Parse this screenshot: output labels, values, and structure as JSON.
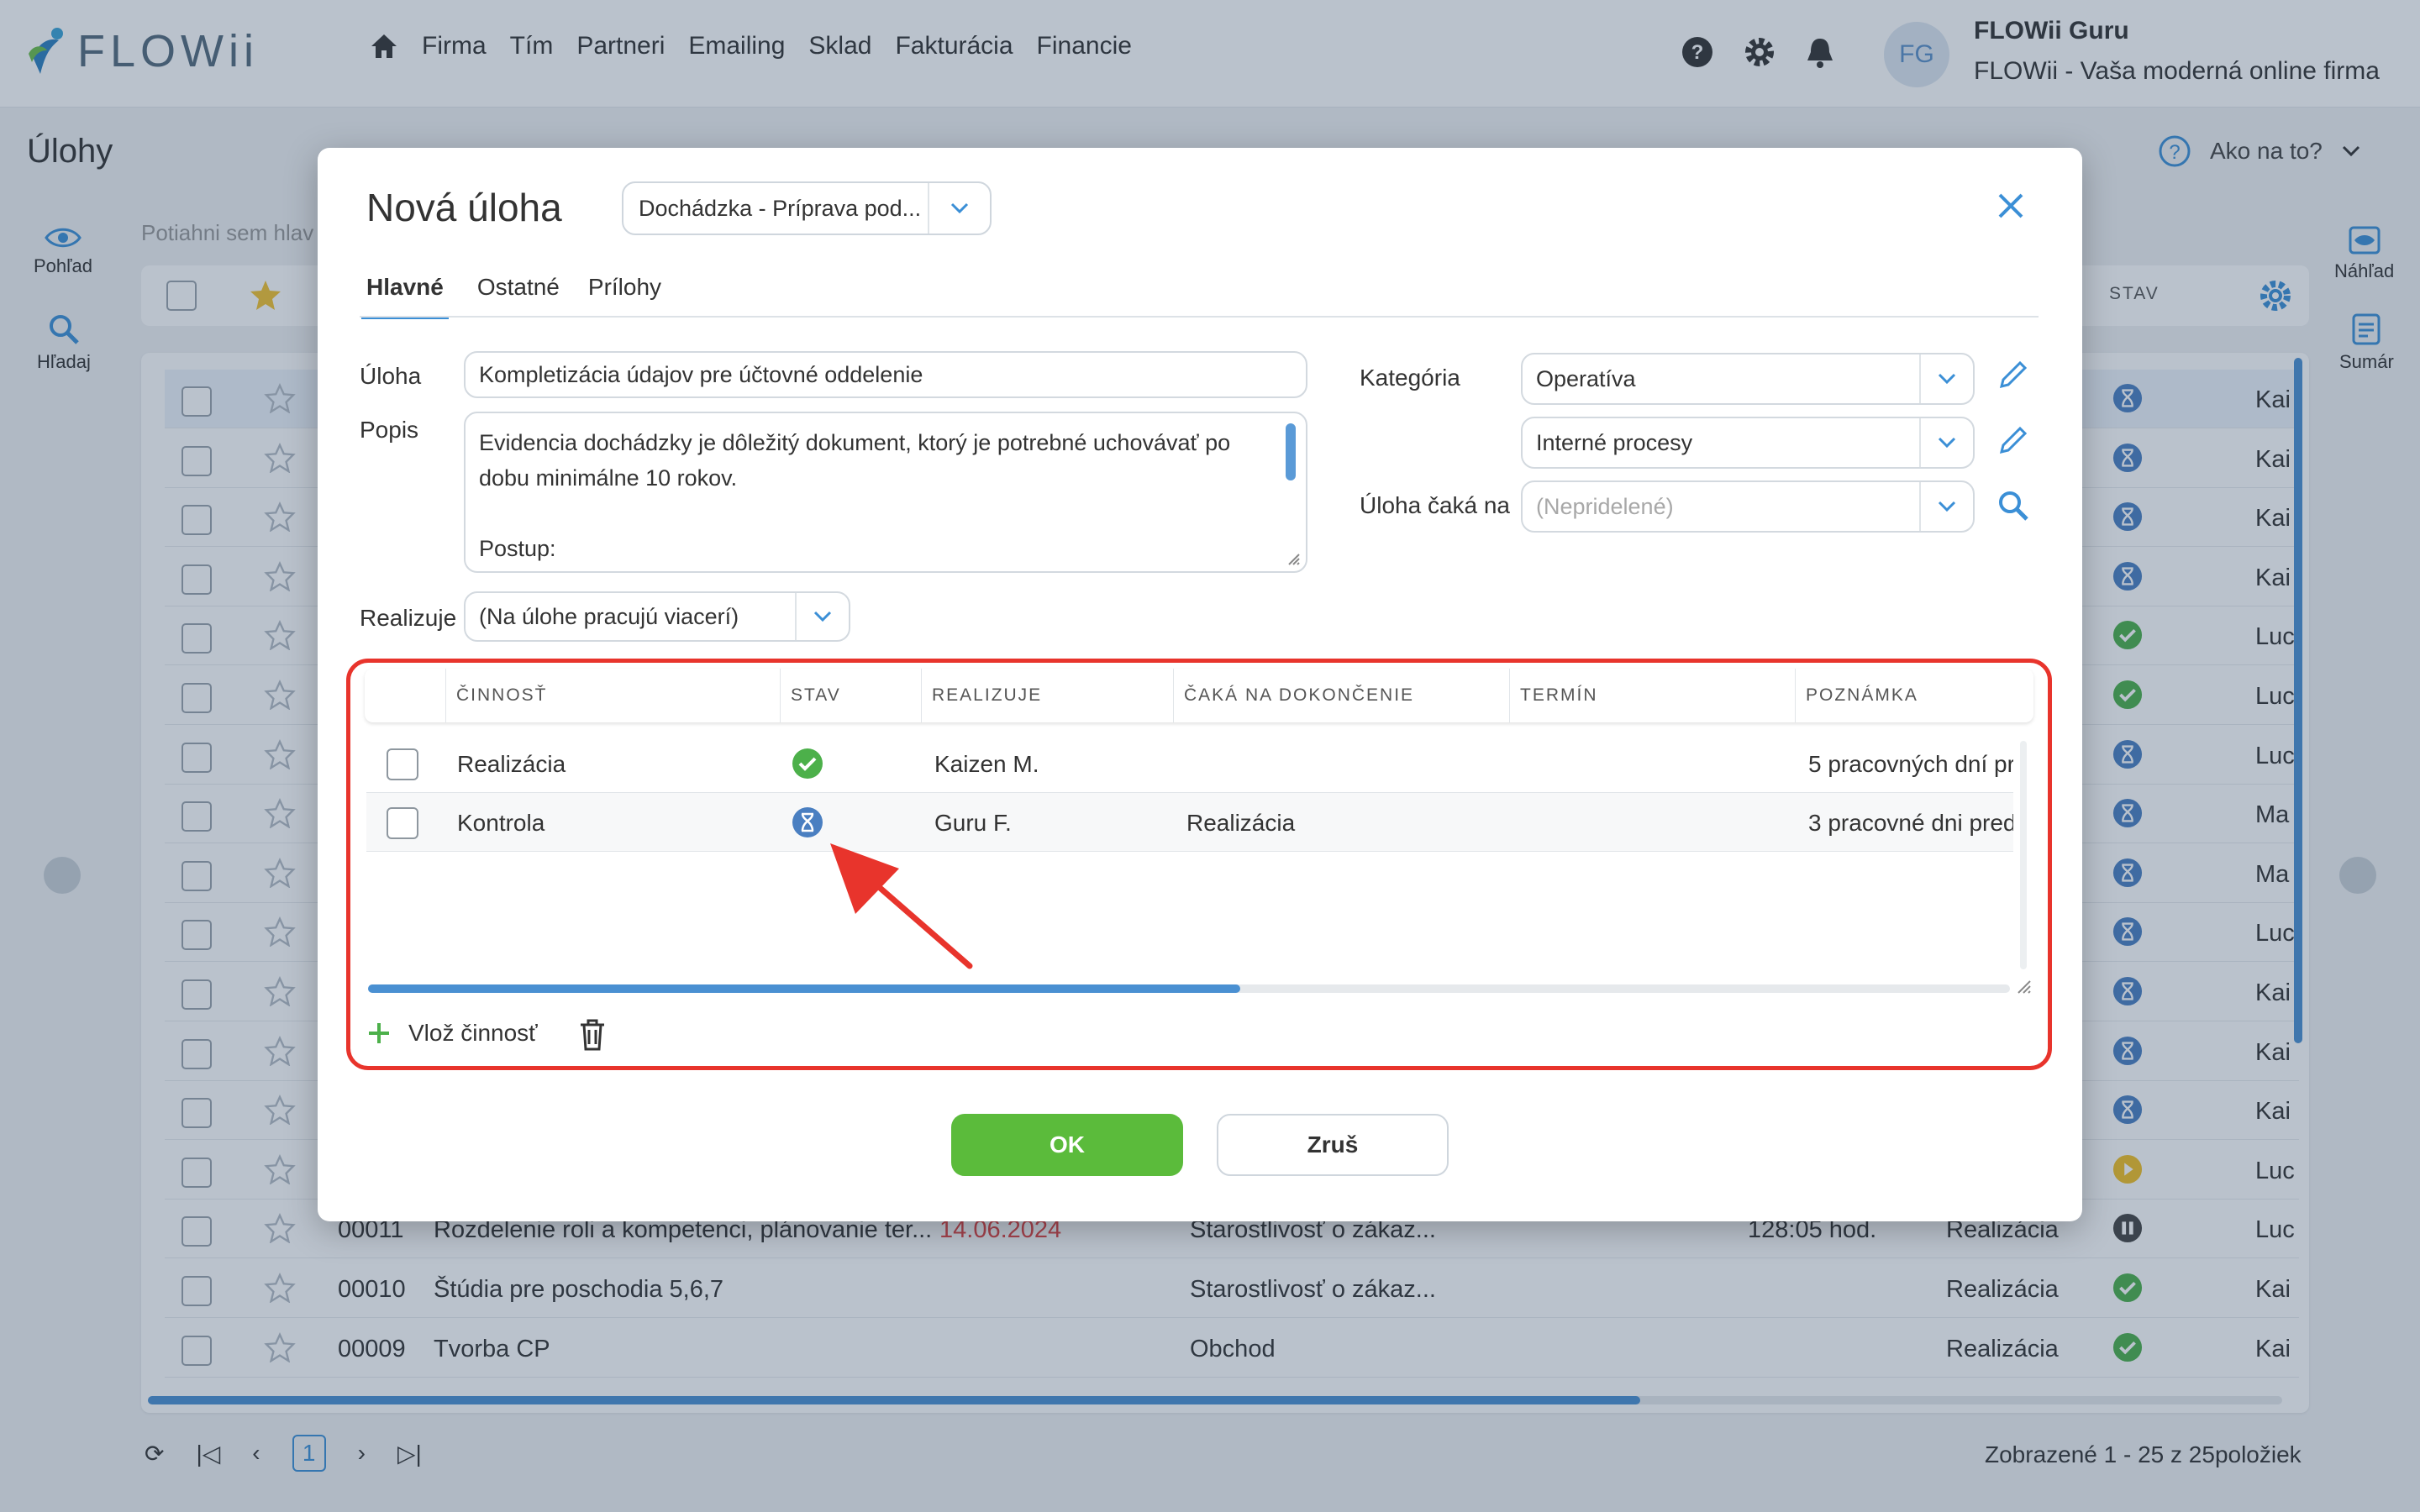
{
  "app": {
    "logo_text": "FLOWii"
  },
  "nav": [
    "Firma",
    "Tím",
    "Partneri",
    "Emailing",
    "Sklad",
    "Fakturácia",
    "Financie"
  ],
  "user": {
    "initials": "FG",
    "name": "FLOWii Guru",
    "company": "FLOWii - Vaša moderná online firma"
  },
  "page": {
    "title": "Úlohy",
    "help": "Ako na to?",
    "drag_hint": "Potiahni sem hlav",
    "status_col": "STAV",
    "pagination_info": "Zobrazené 1 - 25 z 25položiek",
    "current_page": "1"
  },
  "left_rail": [
    {
      "label": "Pohľad",
      "icon": "eye-icon"
    },
    {
      "label": "Hľadaj",
      "icon": "search-icon"
    }
  ],
  "right_rail": [
    {
      "label": "Náhľad",
      "icon": "preview-icon"
    },
    {
      "label": "Sumár",
      "icon": "summary-icon"
    }
  ],
  "background_rows": [
    {
      "status": "waiting",
      "who": "Kai"
    },
    {
      "status": "waiting",
      "who": "Kai"
    },
    {
      "status": "waiting",
      "who": "Kai"
    },
    {
      "status": "waiting",
      "who": "Kai"
    },
    {
      "status": "done",
      "who": "Luc"
    },
    {
      "status": "done",
      "who": "Luc"
    },
    {
      "status": "waiting",
      "who": "Luc"
    },
    {
      "status": "waiting",
      "who": "Ma"
    },
    {
      "status": "waiting",
      "who": "Ma"
    },
    {
      "status": "waiting",
      "who": "Luc"
    },
    {
      "status": "waiting",
      "who": "Kai"
    },
    {
      "status": "waiting",
      "who": "Kai"
    },
    {
      "status": "waiting",
      "who": "Kai"
    },
    {
      "status": "inprogress",
      "who": "Luc"
    },
    {
      "status": "paused",
      "who": "Luc",
      "num": "00011",
      "name": "Rozdelenie roli a kompetenci, plánovanie ter...",
      "date": "14.06.2024",
      "category": "Starostlivosť o zákaz...",
      "hours": "128:05 hod.",
      "phase": "Realizácia"
    },
    {
      "status": "done",
      "who": "Kai",
      "num": "00010",
      "name": "Štúdia pre poschodia 5,6,7",
      "category": "Starostlivosť o zákaz...",
      "phase": "Realizácia"
    },
    {
      "status": "done",
      "who": "Kai",
      "num": "00009",
      "name": "Tvorba CP",
      "category": "Obchod",
      "phase": "Realizácia"
    }
  ],
  "dialog": {
    "title": "Nová úloha",
    "template": "Dochádzka - Príprava pod...",
    "tabs": [
      "Hlavné",
      "Ostatné",
      "Prílohy"
    ],
    "active_tab": "Hlavné",
    "labels": {
      "task": "Úloha",
      "description": "Popis",
      "realizes": "Realizuje",
      "category": "Kategória",
      "waits_on": "Úloha čaká na"
    },
    "task_value": "Kompletizácia údajov pre účtovné oddelenie",
    "description_lines": [
      "Evidencia dochádzky je dôležitý dokument, ktorý je potrebné uchovávať po",
      "dobu minimálne 10 rokov.",
      "",
      "Postup:"
    ],
    "realizes_value": "(Na úlohe pracujú viacerí)",
    "category_value": "Operatíva",
    "category2_value": "Interné procesy",
    "waits_on_placeholder": "(Nepridelené)",
    "activities": {
      "headers": [
        "ČINNOSŤ",
        "STAV",
        "REALIZUJE",
        "ČAKÁ NA DOKONČENIE",
        "TERMÍN",
        "POZNÁMKA"
      ],
      "rows": [
        {
          "name": "Realizácia",
          "status": "done",
          "who": "Kaizen M.",
          "waits": "",
          "deadline": "",
          "note": "5 pracovných dní pr"
        },
        {
          "name": "Kontrola",
          "status": "waiting",
          "who": "Guru F.",
          "waits": "Realizácia",
          "deadline": "",
          "note": "3 pracovné dni pred"
        }
      ],
      "add_label": "Vlož činnosť"
    },
    "ok_label": "OK",
    "cancel_label": "Zruš"
  },
  "colors": {
    "accent": "#3b8fd6",
    "ok_green": "#5bbb3b",
    "highlight_red": "#e8342c",
    "status_done": "#4cb04a",
    "status_waiting": "#4a7fc1"
  }
}
